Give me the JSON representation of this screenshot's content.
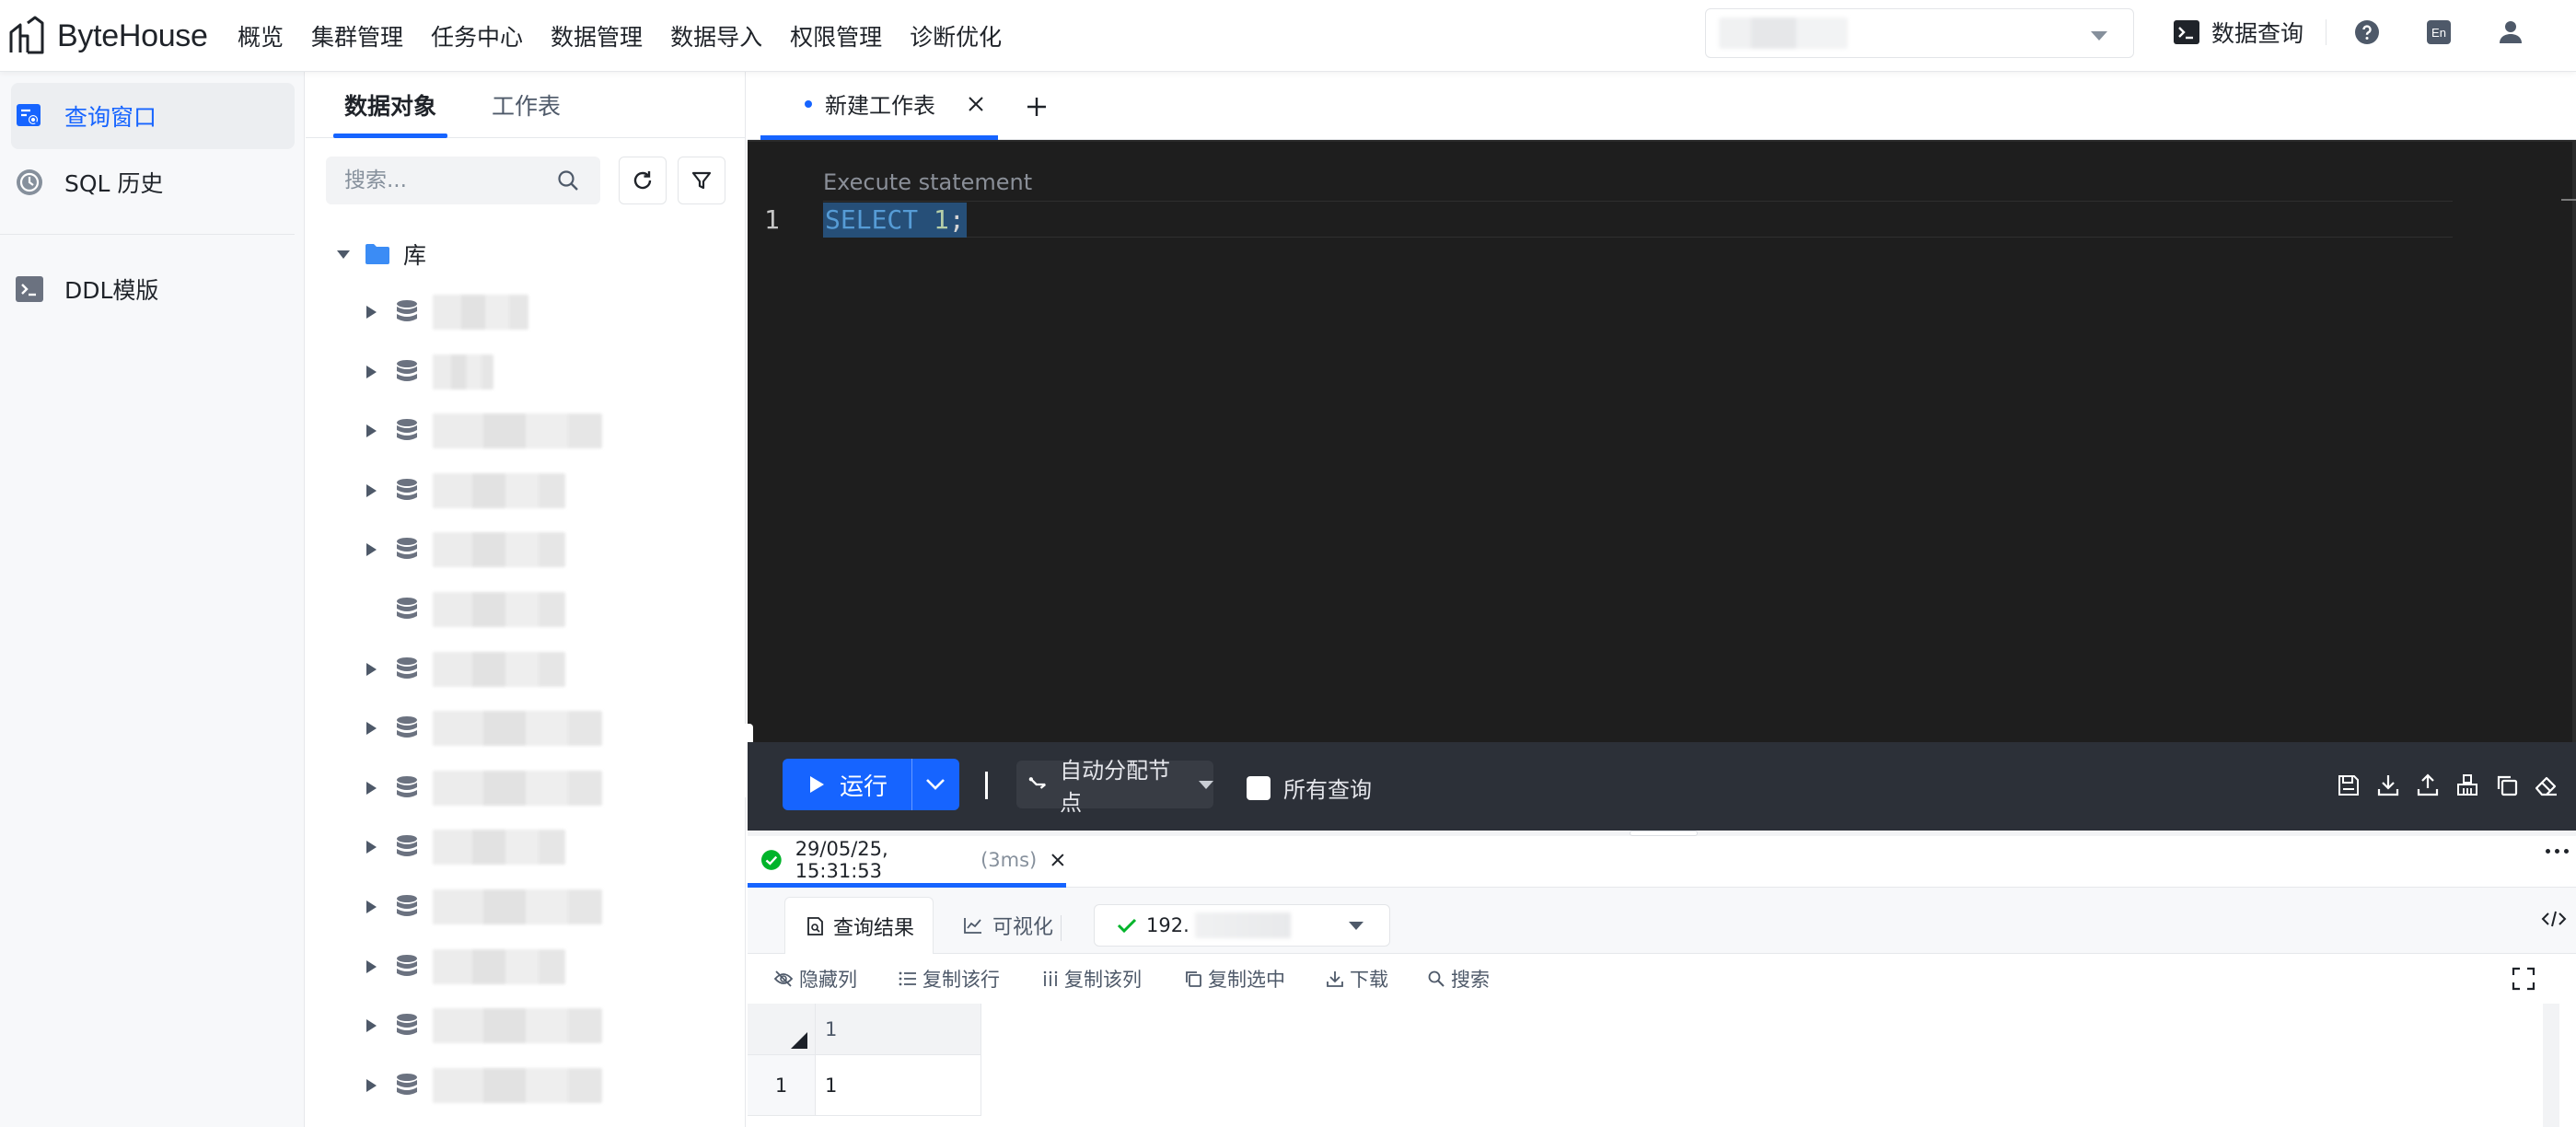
{
  "app": {
    "brand": "ByteHouse"
  },
  "nav": {
    "items": [
      "概览",
      "集群管理",
      "任务中心",
      "数据管理",
      "数据导入",
      "权限管理",
      "诊断优化"
    ]
  },
  "topbar": {
    "data_query_label": "数据查询",
    "lang_label": "En"
  },
  "sidebar": {
    "items": [
      {
        "label": "查询窗口",
        "icon": "query-window-icon",
        "active": true
      },
      {
        "label": "SQL 历史",
        "icon": "history-icon",
        "active": false
      },
      {
        "label": "DDL模版",
        "icon": "terminal-icon",
        "active": false
      }
    ]
  },
  "objects": {
    "tabs": [
      "数据对象",
      "工作表"
    ],
    "search_placeholder": "搜索...",
    "tree_root_label": "库"
  },
  "editor": {
    "tab_label": "新建工作表",
    "placeholder": "Execute statement",
    "line_number": "1",
    "code": {
      "keyword": "SELECT",
      "number": "1",
      "punct": ";"
    }
  },
  "runbar": {
    "run_label": "运行",
    "node_label": "自动分配节点",
    "all_queries_label": "所有查询"
  },
  "result": {
    "timestamp": "29/05/25, 15:31:53",
    "duration": "(3ms)",
    "tabs": [
      "查询结果",
      "可视化"
    ],
    "host_prefix": "192.",
    "actions": [
      "隐藏列",
      "复制该行",
      "复制该列",
      "复制选中",
      "下载",
      "搜索"
    ],
    "column_header": "1",
    "row_number": "1",
    "cell_value": "1"
  },
  "colors": {
    "accent": "#1664ff",
    "editor_bg": "#1e1e1e",
    "runbar_bg": "#2c3038",
    "success": "#00b42a"
  }
}
